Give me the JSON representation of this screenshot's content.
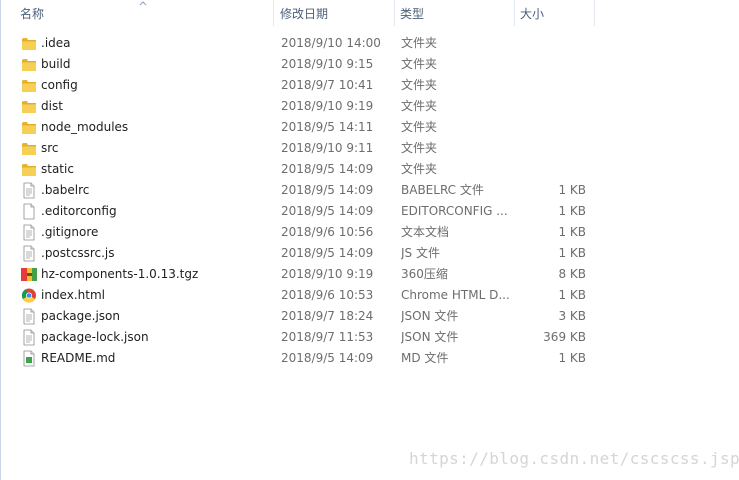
{
  "columns": {
    "name": "名称",
    "date": "修改日期",
    "type": "类型",
    "size": "大小"
  },
  "files": [
    {
      "name": ".idea",
      "date": "2018/9/10 14:00",
      "type": "文件夹",
      "size": "",
      "icon": "folder-icon"
    },
    {
      "name": "build",
      "date": "2018/9/10 9:15",
      "type": "文件夹",
      "size": "",
      "icon": "folder-icon"
    },
    {
      "name": "config",
      "date": "2018/9/7 10:41",
      "type": "文件夹",
      "size": "",
      "icon": "folder-icon"
    },
    {
      "name": "dist",
      "date": "2018/9/10 9:19",
      "type": "文件夹",
      "size": "",
      "icon": "folder-icon"
    },
    {
      "name": "node_modules",
      "date": "2018/9/5 14:11",
      "type": "文件夹",
      "size": "",
      "icon": "folder-icon"
    },
    {
      "name": "src",
      "date": "2018/9/10 9:11",
      "type": "文件夹",
      "size": "",
      "icon": "folder-icon"
    },
    {
      "name": "static",
      "date": "2018/9/5 14:09",
      "type": "文件夹",
      "size": "",
      "icon": "folder-icon"
    },
    {
      "name": ".babelrc",
      "date": "2018/9/5 14:09",
      "type": "BABELRC 文件",
      "size": "1 KB",
      "icon": "text-file-icon"
    },
    {
      "name": ".editorconfig",
      "date": "2018/9/5 14:09",
      "type": "EDITORCONFIG ...",
      "size": "1 KB",
      "icon": "blank-file-icon"
    },
    {
      "name": ".gitignore",
      "date": "2018/9/6 10:56",
      "type": "文本文档",
      "size": "1 KB",
      "icon": "text-file-icon"
    },
    {
      "name": ".postcssrc.js",
      "date": "2018/9/5 14:09",
      "type": "JS 文件",
      "size": "1 KB",
      "icon": "text-file-icon"
    },
    {
      "name": "hz-components-1.0.13.tgz",
      "date": "2018/9/10 9:19",
      "type": "360压缩",
      "size": "8 KB",
      "icon": "archive-icon"
    },
    {
      "name": "index.html",
      "date": "2018/9/6 10:53",
      "type": "Chrome HTML D...",
      "size": "1 KB",
      "icon": "chrome-icon"
    },
    {
      "name": "package.json",
      "date": "2018/9/7 18:24",
      "type": "JSON 文件",
      "size": "3 KB",
      "icon": "text-file-icon"
    },
    {
      "name": "package-lock.json",
      "date": "2018/9/7 11:53",
      "type": "JSON 文件",
      "size": "369 KB",
      "icon": "text-file-icon"
    },
    {
      "name": "README.md",
      "date": "2018/9/5 14:09",
      "type": "MD 文件",
      "size": "1 KB",
      "icon": "md-file-icon"
    }
  ],
  "watermark": "https://blog.csdn.net/cscscss.jsp"
}
